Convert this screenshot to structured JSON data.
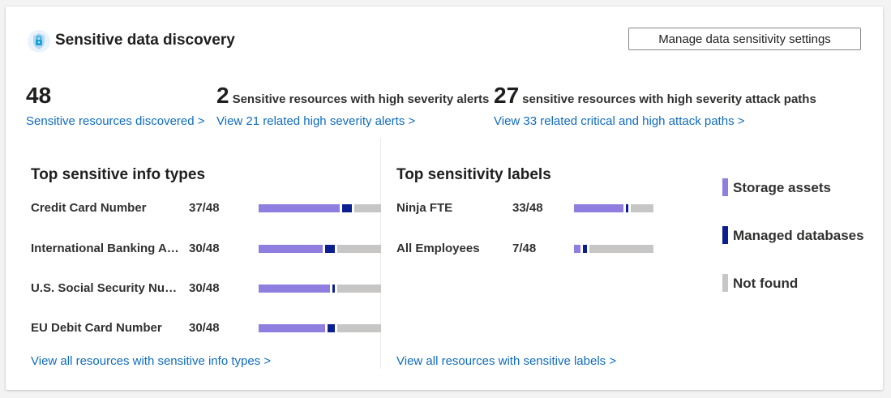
{
  "header": {
    "title": "Sensitive data discovery",
    "manage_button_label": "Manage data sensitivity settings"
  },
  "metrics": [
    {
      "value": "48",
      "description": "",
      "link": "Sensitive resources discovered >"
    },
    {
      "value": "2",
      "description": "Sensitive resources with high severity alerts",
      "link": "View 21 related high severity alerts >"
    },
    {
      "value": "27",
      "description": "sensitive resources with high severity attack paths",
      "link": "View 33 related critical and high attack paths >"
    }
  ],
  "info_types": {
    "title": "Top sensitive info types",
    "rows": [
      {
        "label": "Credit Card Number",
        "count": "37/48",
        "storage": 33,
        "managed": 4,
        "not_found": 11
      },
      {
        "label": "International Banking Account Number",
        "count": "30/48",
        "storage": 26,
        "managed": 4,
        "not_found": 18
      },
      {
        "label": "U.S. Social Security Number",
        "count": "30/48",
        "storage": 29,
        "managed": 1,
        "not_found": 18
      },
      {
        "label": "EU Debit Card Number",
        "count": "30/48",
        "storage": 27,
        "managed": 3,
        "not_found": 18
      }
    ],
    "link": "View all resources with sensitive info types >"
  },
  "sensitivity_labels": {
    "title": "Top sensitivity labels",
    "rows": [
      {
        "label": "Ninja FTE",
        "count": "33/48",
        "storage": 32,
        "managed": 1,
        "not_found": 15
      },
      {
        "label": "All Employees",
        "count": "7/48",
        "storage": 4,
        "managed": 3,
        "not_found": 41
      }
    ],
    "link": "View all resources with sensitive labels >"
  },
  "legend": [
    {
      "label": "Storage assets",
      "color": "#8f7ee0"
    },
    {
      "label": "Managed databases",
      "color": "#0b1f8f"
    },
    {
      "label": "Not found",
      "color": "#c8c6c4"
    }
  ]
}
